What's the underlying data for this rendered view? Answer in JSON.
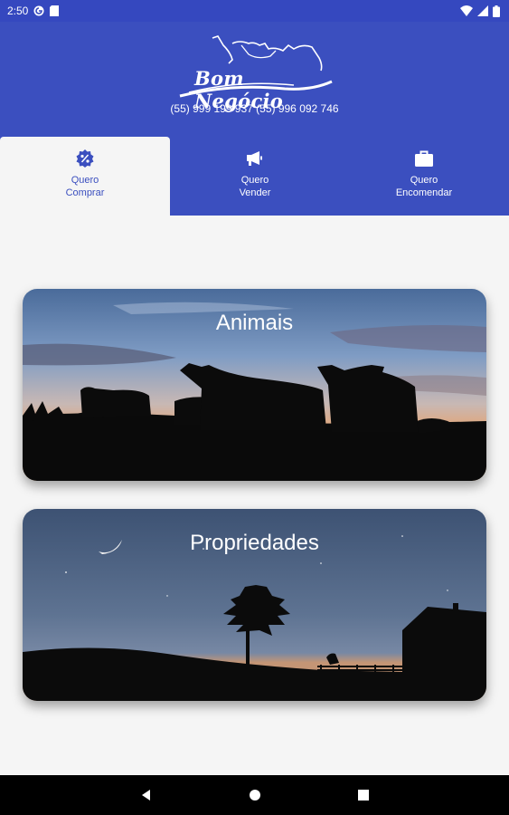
{
  "status_bar": {
    "time": "2:50",
    "icons": [
      "gmail-icon",
      "card-icon",
      "wifi-icon",
      "signal-icon",
      "battery-icon"
    ]
  },
  "header": {
    "logo_text": "Bom Negócio",
    "phones": "(55) 999 199 937 (55) 996 092 746",
    "background_color": "#3b4fbf"
  },
  "tabs": [
    {
      "label": "Quero\nComprar",
      "icon": "badge-percent-icon",
      "active": true
    },
    {
      "label": "Quero\nVender",
      "icon": "megaphone-icon",
      "active": false
    },
    {
      "label": "Quero\nEncomendar",
      "icon": "briefcase-icon",
      "active": false
    }
  ],
  "cards": [
    {
      "title": "Animais"
    },
    {
      "title": "Propriedades"
    }
  ],
  "nav": {
    "back": "back-icon",
    "home": "home-icon",
    "recents": "recents-icon"
  }
}
